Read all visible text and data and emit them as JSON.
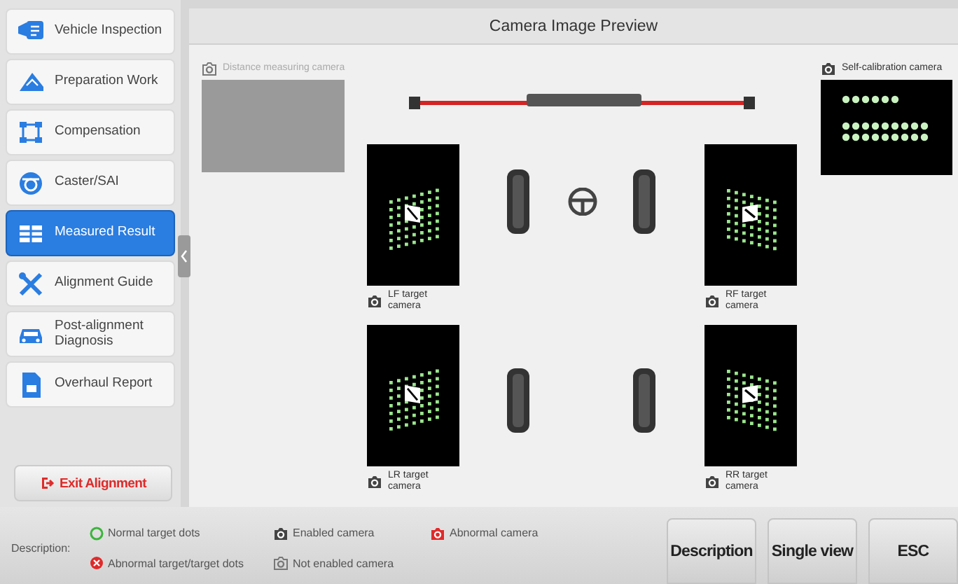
{
  "sidebar": {
    "items": [
      {
        "label": "Vehicle Inspection",
        "selected": false
      },
      {
        "label": "Preparation Work",
        "selected": false
      },
      {
        "label": "Compensation",
        "selected": false
      },
      {
        "label": "Caster/SAI",
        "selected": false
      },
      {
        "label": "Measured Result",
        "selected": true
      },
      {
        "label": "Alignment Guide",
        "selected": false
      },
      {
        "label": "Post-alignment Diagnosis",
        "selected": false
      },
      {
        "label": "Overhaul Report",
        "selected": false
      }
    ],
    "exit_button": "Exit Alignment"
  },
  "preview": {
    "title": "Camera Image Preview",
    "cameras": [
      {
        "kind": "distance",
        "label": "Distance measuring camera",
        "enabled": false
      },
      {
        "kind": "self_calibration",
        "label": "Self-calibration camera",
        "enabled": true
      },
      {
        "kind": "target",
        "label": "LF target camera",
        "enabled": true
      },
      {
        "kind": "target",
        "label": "RF target camera",
        "enabled": true
      },
      {
        "kind": "target",
        "label": "LR target camera",
        "enabled": true
      },
      {
        "kind": "target",
        "label": "RR target camera",
        "enabled": true
      }
    ]
  },
  "legend": {
    "label": "Description:",
    "items": [
      {
        "kind": "normal_dots",
        "label": "Normal target dots"
      },
      {
        "kind": "enabled_camera",
        "label": "Enabled camera"
      },
      {
        "kind": "abnormal_camera",
        "label": "Abnormal camera"
      },
      {
        "kind": "abnormal_dots",
        "label": "Abnormal target/target dots"
      },
      {
        "kind": "disabled_camera",
        "label": "Not enabled camera"
      }
    ]
  },
  "buttons": [
    "Description",
    "Single view",
    "ESC"
  ]
}
